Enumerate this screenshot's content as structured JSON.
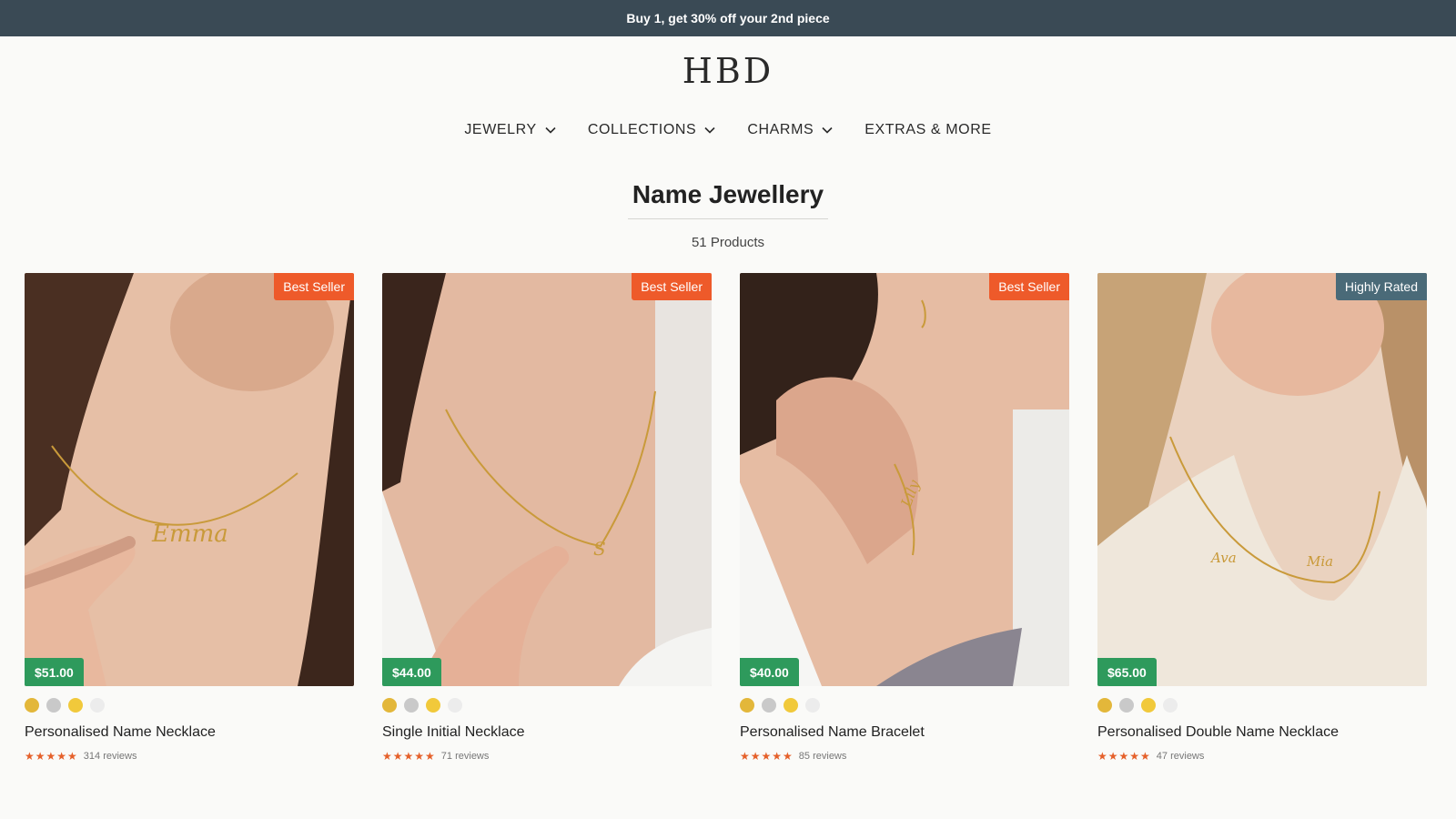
{
  "announcement": "Buy 1, get 30% off your 2nd piece",
  "brand": "HBD",
  "nav": [
    {
      "label": "JEWELRY",
      "dropdown": true
    },
    {
      "label": "COLLECTIONS",
      "dropdown": true
    },
    {
      "label": "CHARMS",
      "dropdown": true
    },
    {
      "label": "EXTRAS & MORE",
      "dropdown": false
    }
  ],
  "page": {
    "title": "Name Jewellery",
    "count": "51 Products"
  },
  "colors": {
    "announcement_bg": "#3a4a55",
    "best_seller": "#ee5a2a",
    "highly_rated": "#4a6a78",
    "price_tag": "#2e9a5c",
    "stars": "#e5602a",
    "swatch_gold": "#e3b73a",
    "swatch_silver": "#c9c9c9",
    "swatch_yellow": "#f1c93b",
    "swatch_white": "#ececec"
  },
  "products": [
    {
      "name": "Personalised Name Necklace",
      "price": "$51.00",
      "badge": "Best Seller",
      "badge_type": "best_seller",
      "rating": 5,
      "reviews": "314 reviews",
      "swatches": [
        "gold",
        "silver",
        "yellow",
        "white"
      ]
    },
    {
      "name": "Single Initial Necklace",
      "price": "$44.00",
      "badge": "Best Seller",
      "badge_type": "best_seller",
      "rating": 5,
      "reviews": "71 reviews",
      "swatches": [
        "gold",
        "silver",
        "yellow",
        "white"
      ]
    },
    {
      "name": "Personalised Name Bracelet",
      "price": "$40.00",
      "badge": "Best Seller",
      "badge_type": "best_seller",
      "rating": 5,
      "reviews": "85 reviews",
      "swatches": [
        "gold",
        "silver",
        "yellow",
        "white"
      ]
    },
    {
      "name": "Personalised Double Name Necklace",
      "price": "$65.00",
      "badge": "Highly Rated",
      "badge_type": "highly_rated",
      "rating": 5,
      "reviews": "47 reviews",
      "swatches": [
        "gold",
        "silver",
        "yellow",
        "white"
      ]
    }
  ]
}
